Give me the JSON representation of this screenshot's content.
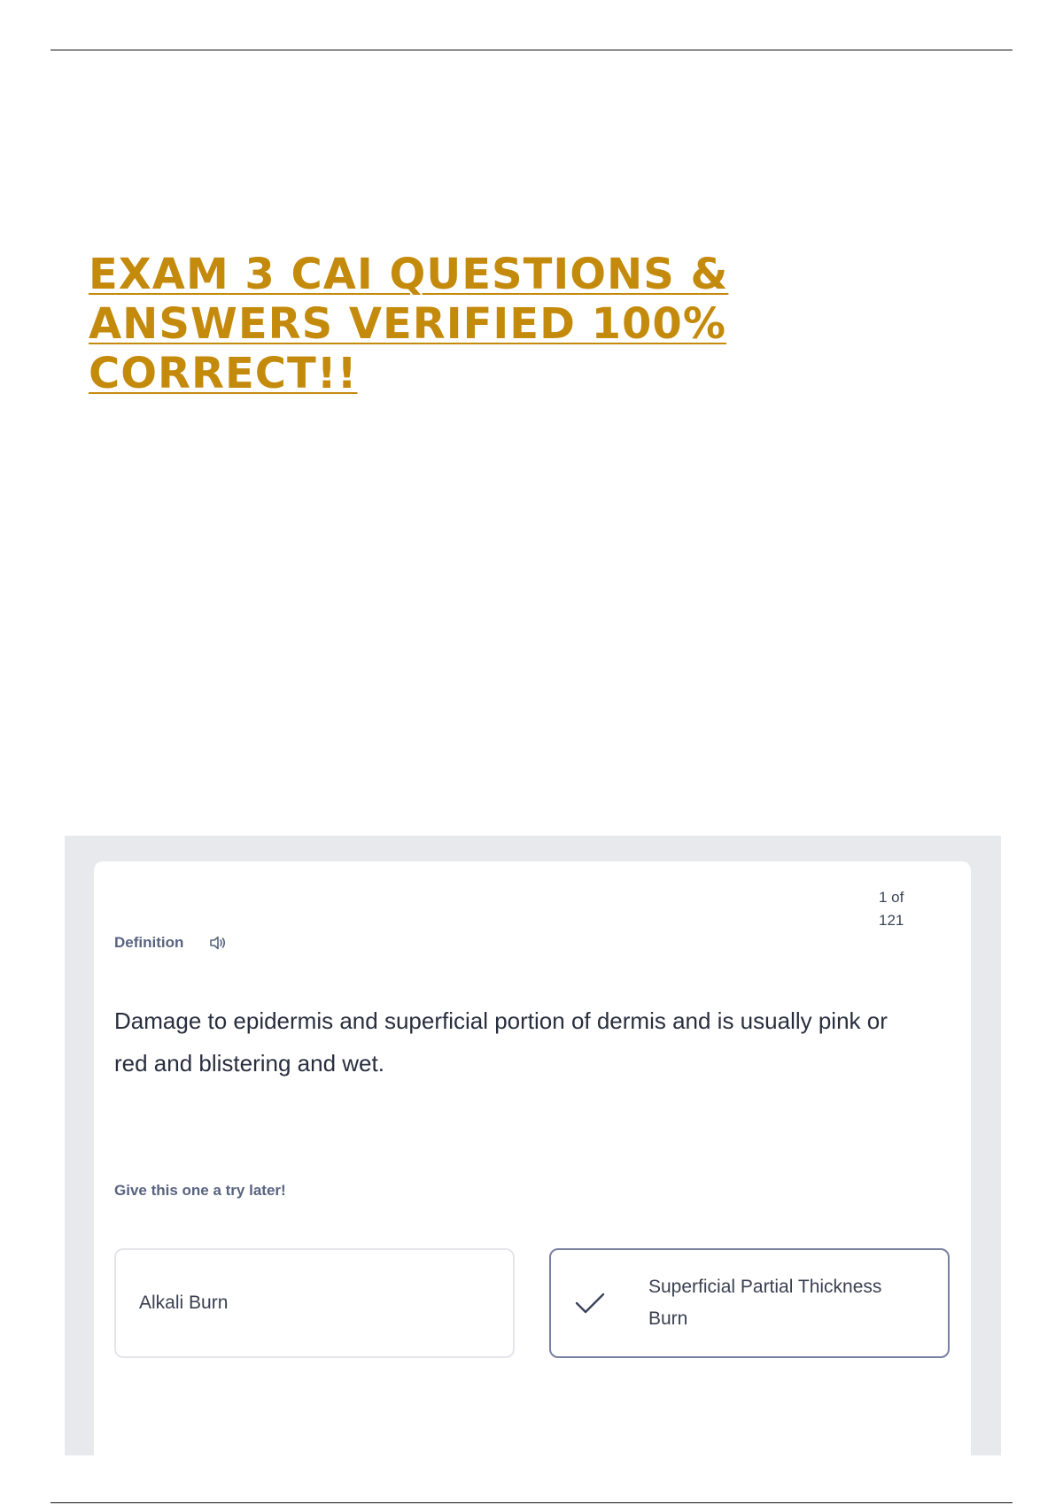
{
  "document": {
    "title": "EXAM 3 CAI QUESTIONS & ANSWERS VERIFIED 100% CORRECT!!"
  },
  "card": {
    "counter": "1 of 121",
    "label": "Definition",
    "speaker_icon": "speaker-icon",
    "definition": "Damage to epidermis and superficial portion of dermis and is usually pink or red and blistering and wet.",
    "hint": "Give this one a try later!",
    "options": [
      {
        "label": "Alkali Burn",
        "selected": false
      },
      {
        "label": "Superficial Partial Thickness Burn",
        "selected": true,
        "icon": "check-icon"
      }
    ]
  },
  "colors": {
    "title": "#c48a0c",
    "panel_bg": "#e8e9ec",
    "muted_label": "#586380",
    "selected_border": "#7a80a0"
  }
}
